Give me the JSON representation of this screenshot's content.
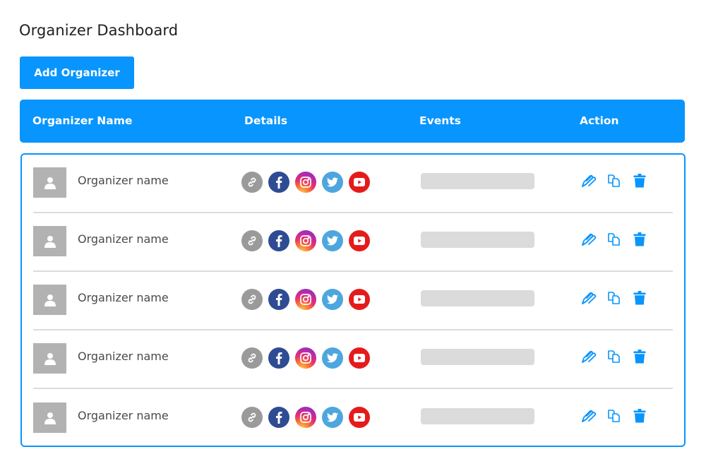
{
  "page": {
    "title": "Organizer Dashboard",
    "add_button_label": "Add Organizer"
  },
  "colors": {
    "accent": "#0895fd",
    "avatar_bg": "#b2b2b2",
    "events_placeholder": "#dbdbdb",
    "divider": "#dcdcdc"
  },
  "table": {
    "columns": [
      "Organizer Name",
      "Details",
      "Events",
      "Action"
    ],
    "social_icons": [
      "link-icon",
      "facebook-icon",
      "instagram-icon",
      "twitter-icon",
      "youtube-icon"
    ],
    "action_icons": [
      "edit-pencil-icon",
      "copy-icon",
      "trash-icon"
    ],
    "rows": [
      {
        "name": "Organizer name",
        "avatar": "user-placeholder-icon",
        "events": ""
      },
      {
        "name": "Organizer name",
        "avatar": "user-placeholder-icon",
        "events": ""
      },
      {
        "name": "Organizer name",
        "avatar": "user-placeholder-icon",
        "events": ""
      },
      {
        "name": "Organizer name",
        "avatar": "user-placeholder-icon",
        "events": ""
      },
      {
        "name": "Organizer name",
        "avatar": "user-placeholder-icon",
        "events": ""
      }
    ]
  }
}
